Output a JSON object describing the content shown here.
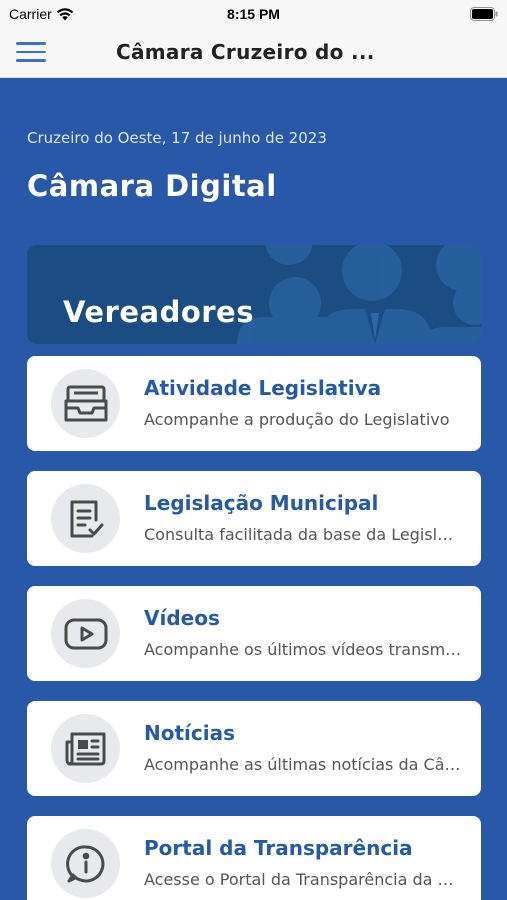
{
  "status_bar": {
    "carrier": "Carrier",
    "time": "8:15 PM"
  },
  "header": {
    "title": "Câmara Cruzeiro do ..."
  },
  "main": {
    "date": "Cruzeiro do Oeste, 17 de junho de 2023",
    "title": "Câmara Digital",
    "banner": {
      "label": "Vereadores"
    },
    "cards": [
      {
        "title": "Atividade Legislativa",
        "subtitle": "Acompanhe a produção do Legislativo",
        "icon": "archive-tray-icon"
      },
      {
        "title": "Legislação Municipal",
        "subtitle": "Consulta facilitada da base da Legislação",
        "icon": "document-check-icon"
      },
      {
        "title": "Vídeos",
        "subtitle": "Acompanhe os últimos vídeos transmitidos",
        "icon": "play-video-icon"
      },
      {
        "title": "Notícias",
        "subtitle": "Acompanhe as últimas notícias da Câmara",
        "icon": "newspaper-icon"
      },
      {
        "title": "Portal da Transparência",
        "subtitle": "Acesse o Portal da Transparência da Câmara",
        "icon": "info-icon"
      }
    ]
  },
  "colors": {
    "background": "#2a58a8",
    "banner": "#1b4c82",
    "accent": "#2659a8",
    "menu_icon": "#3d6fd0"
  }
}
